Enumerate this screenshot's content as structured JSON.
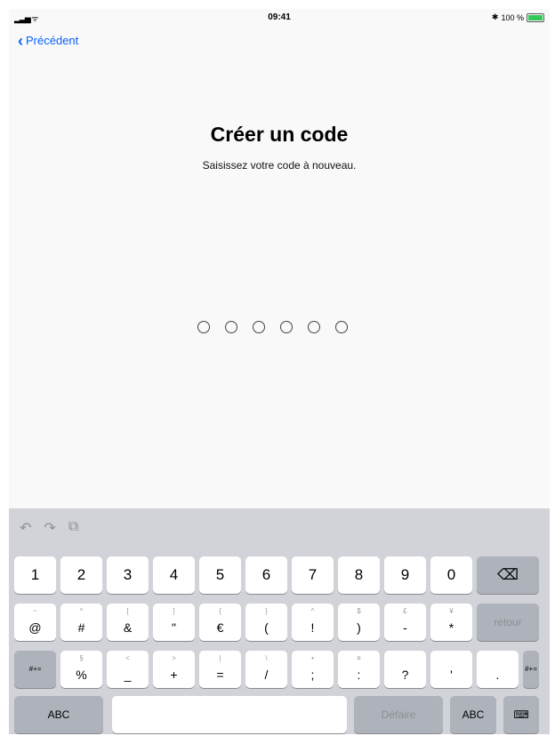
{
  "status": {
    "time": "09:41",
    "battery_text": "100 %",
    "bluetooth": "bluetooth-icon"
  },
  "nav": {
    "back_label": "Précédent"
  },
  "page": {
    "title": "Créer un code",
    "subtitle": "Saisissez votre code à nouveau.",
    "passcode_length": 6,
    "digits_entered": 0
  },
  "keyboard": {
    "toolbar": [
      "undo-icon",
      "redo-icon",
      "paste-icon"
    ],
    "row1": [
      "1",
      "2",
      "3",
      "4",
      "5",
      "6",
      "7",
      "8",
      "9",
      "0"
    ],
    "row2": [
      {
        "top": "~",
        "main": "@"
      },
      {
        "top": "^",
        "main": "#"
      },
      {
        "top": "[",
        "main": "&"
      },
      {
        "top": "]",
        "main": "\""
      },
      {
        "top": "{",
        "main": "€"
      },
      {
        "top": "}",
        "main": "("
      },
      {
        "top": "^",
        "main": "!"
      },
      {
        "top": "$",
        "main": ")"
      },
      {
        "top": "£",
        "main": "-"
      },
      {
        "top": "¥",
        "main": "*"
      }
    ],
    "row3": [
      {
        "top": "§",
        "main": "%"
      },
      {
        "top": "<",
        "main": "_"
      },
      {
        "top": ">",
        "main": "+"
      },
      {
        "top": "|",
        "main": "="
      },
      {
        "top": "\\",
        "main": "/"
      },
      {
        "top": "•",
        "main": ";"
      },
      {
        "top": "¤",
        "main": ":"
      },
      {
        "top": "",
        "main": "?"
      },
      {
        "top": "",
        "main": "'"
      },
      {
        "top": "",
        "main": "."
      }
    ],
    "retour": "retour",
    "symbols": "#+=",
    "abc": "ABC",
    "undo": "Défaire"
  }
}
